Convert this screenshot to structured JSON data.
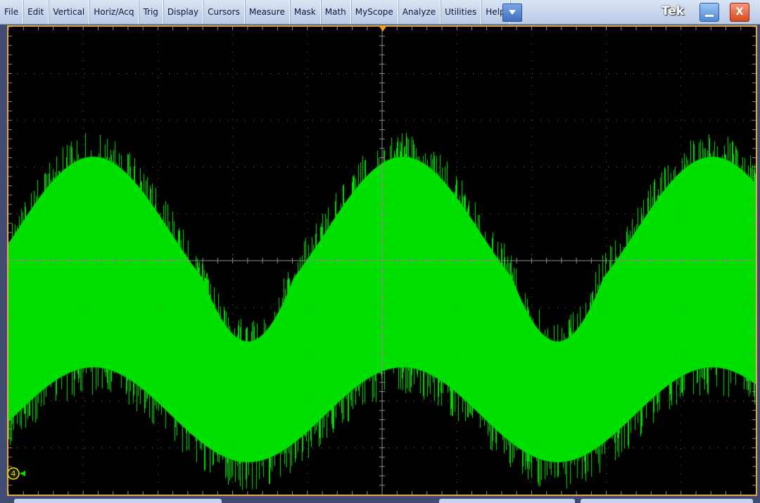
{
  "menu": {
    "items": [
      {
        "id": "file",
        "label": "File"
      },
      {
        "id": "edit",
        "label": "Edit"
      },
      {
        "id": "vertical",
        "label": "Vertical"
      },
      {
        "id": "horiz-acq",
        "label": "Horiz/Acq"
      },
      {
        "id": "trig",
        "label": "Trig"
      },
      {
        "id": "display",
        "label": "Display"
      },
      {
        "id": "cursors",
        "label": "Cursors"
      },
      {
        "id": "measure",
        "label": "Measure"
      },
      {
        "id": "mask",
        "label": "Mask"
      },
      {
        "id": "math",
        "label": "Math"
      },
      {
        "id": "myscope",
        "label": "MyScope"
      },
      {
        "id": "analyze",
        "label": "Analyze"
      },
      {
        "id": "utilities",
        "label": "Utilities"
      },
      {
        "id": "help",
        "label": "Help"
      }
    ]
  },
  "brand": "Tek",
  "window": {
    "close_label": "X"
  },
  "channel": {
    "number": "4",
    "color": "#00e000"
  },
  "colors": {
    "frame": "#e8a84a",
    "trace": "#00e000",
    "grid": "#6a6a6a",
    "trigger": "#f0a020"
  },
  "icons": [
    "dropdown-arrow-icon",
    "minimize-icon",
    "close-icon",
    "trigger-position-icon",
    "channel-ground-icon"
  ]
}
